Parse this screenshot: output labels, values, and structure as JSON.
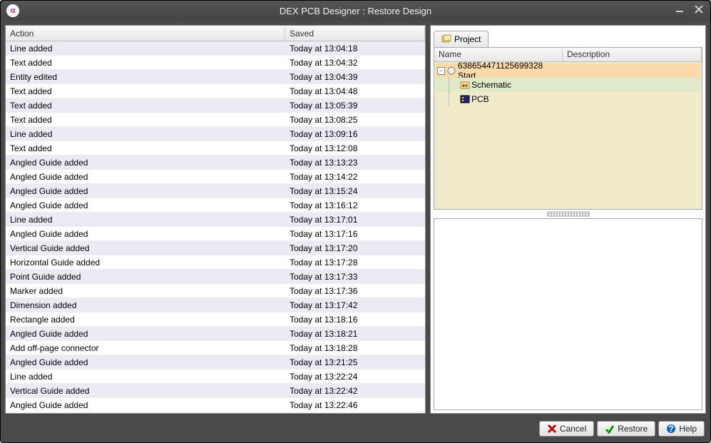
{
  "window": {
    "title": "DEX PCB Designer : Restore Design"
  },
  "columns": {
    "action": "Action",
    "saved": "Saved"
  },
  "rows": [
    {
      "action": "Line added",
      "saved": "Today at 13:04:18"
    },
    {
      "action": "Text added",
      "saved": "Today at 13:04:32"
    },
    {
      "action": "Entity edited",
      "saved": "Today at 13:04:39"
    },
    {
      "action": "Text added",
      "saved": "Today at 13:04:48"
    },
    {
      "action": "Text added",
      "saved": "Today at 13:05:39"
    },
    {
      "action": "Text added",
      "saved": "Today at 13:08:25"
    },
    {
      "action": "Line added",
      "saved": "Today at 13:09:16"
    },
    {
      "action": "Text added",
      "saved": "Today at 13:12:08"
    },
    {
      "action": "Angled Guide added",
      "saved": "Today at 13:13:23"
    },
    {
      "action": "Angled Guide added",
      "saved": "Today at 13:14:22"
    },
    {
      "action": "Angled Guide added",
      "saved": "Today at 13:15:24"
    },
    {
      "action": "Angled Guide added",
      "saved": "Today at 13:16:12"
    },
    {
      "action": "Line added",
      "saved": "Today at 13:17:01"
    },
    {
      "action": "Angled Guide added",
      "saved": "Today at 13:17:16"
    },
    {
      "action": "Vertical Guide added",
      "saved": "Today at 13:17:20"
    },
    {
      "action": "Horizontal Guide added",
      "saved": "Today at 13:17:28"
    },
    {
      "action": "Point Guide added",
      "saved": "Today at 13:17:33"
    },
    {
      "action": "Marker added",
      "saved": "Today at 13:17:36"
    },
    {
      "action": "Dimension added",
      "saved": "Today at 13:17:42"
    },
    {
      "action": "Rectangle added",
      "saved": "Today at 13:18:16"
    },
    {
      "action": "Angled Guide added",
      "saved": "Today at 13:18:21"
    },
    {
      "action": "Add off-page connector",
      "saved": "Today at 13:18:28"
    },
    {
      "action": "Angled Guide added",
      "saved": "Today at 13:21:25"
    },
    {
      "action": "Line added",
      "saved": "Today at 13:22:24"
    },
    {
      "action": "Vertical Guide added",
      "saved": "Today at 13:22:42"
    },
    {
      "action": "Angled Guide added",
      "saved": "Today at 13:22:46"
    }
  ],
  "tab": {
    "label": "Project"
  },
  "treeColumns": {
    "name": "Name",
    "description": "Description"
  },
  "tree": {
    "root": {
      "label": "638654471125699328 Start"
    },
    "child1": {
      "label": "Schematic"
    },
    "child2": {
      "label": "PCB"
    }
  },
  "buttons": {
    "cancel": "Cancel",
    "restore": "Restore",
    "help": "Help"
  }
}
